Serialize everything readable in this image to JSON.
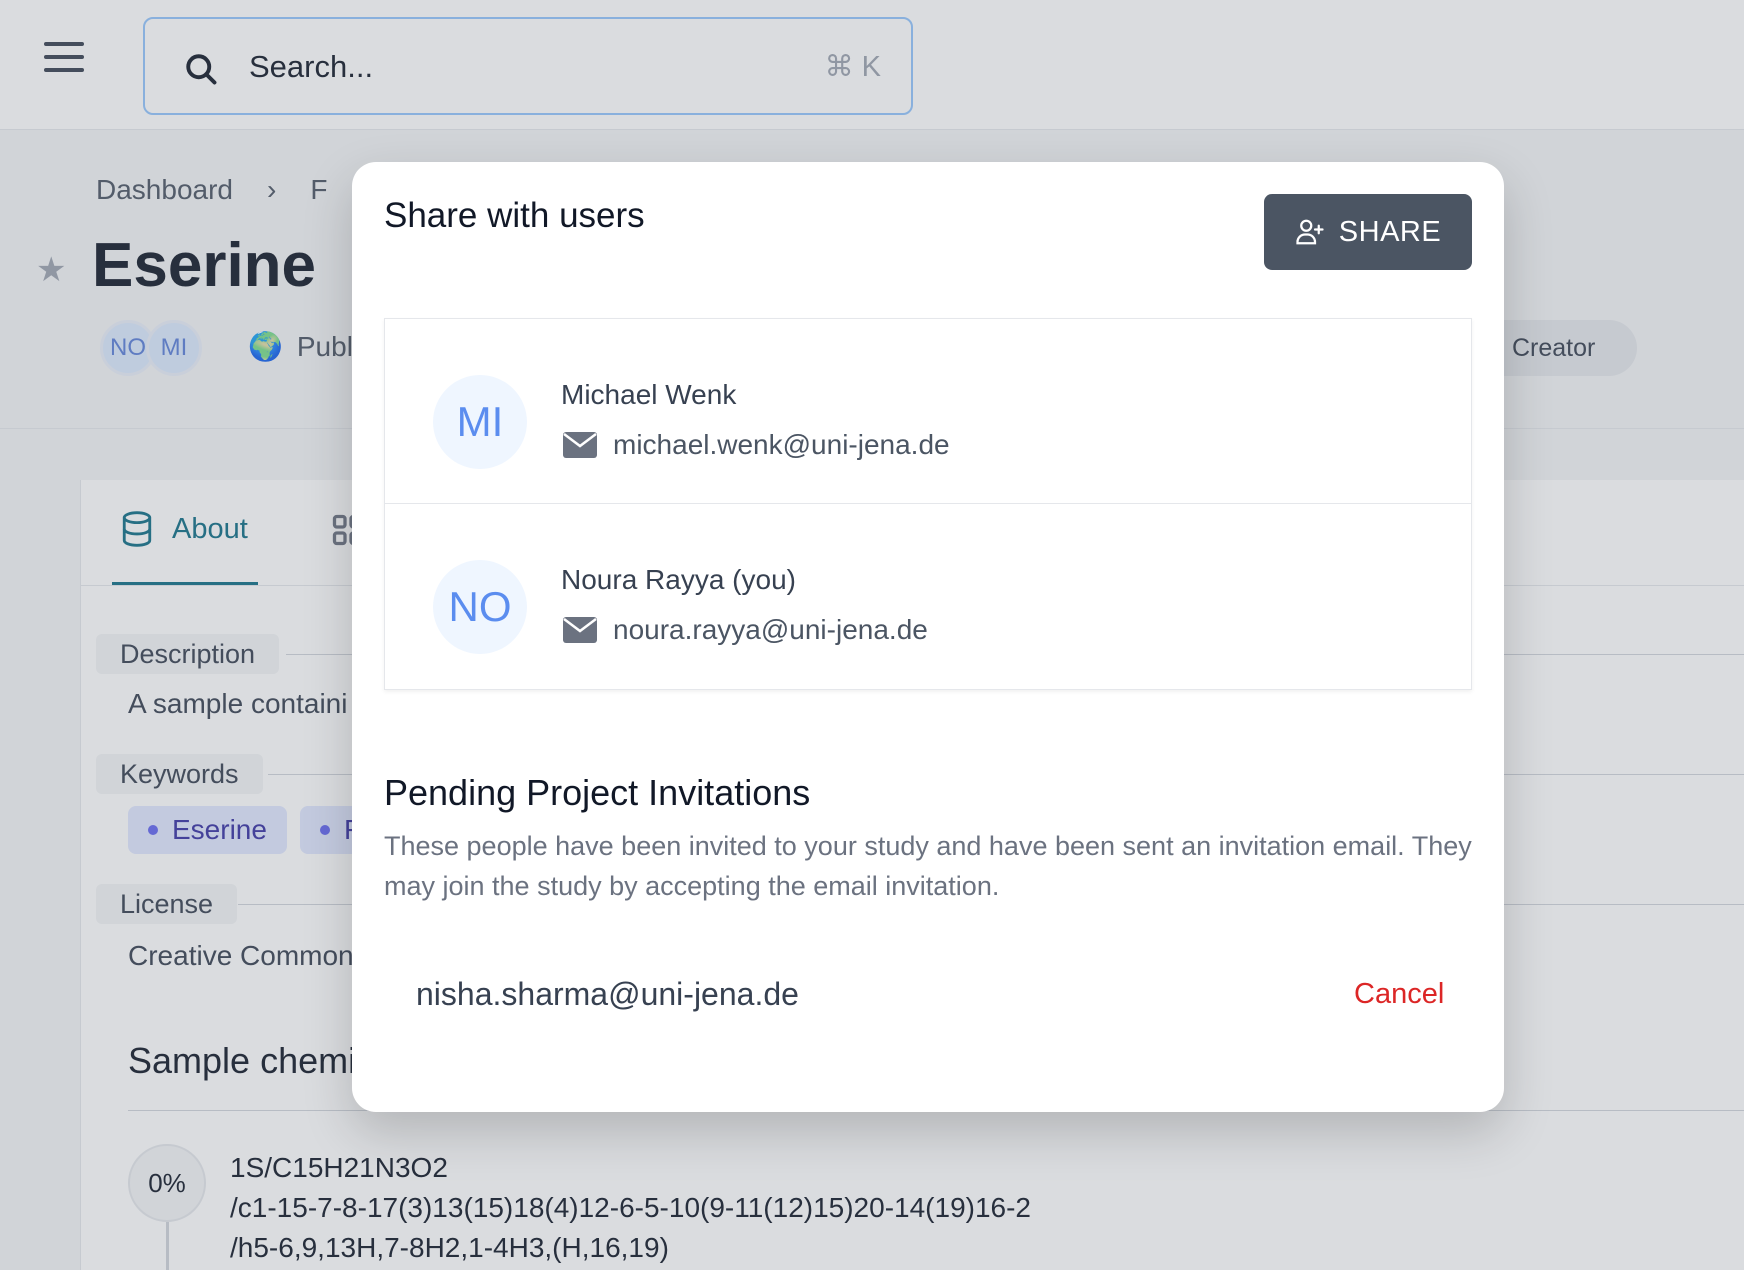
{
  "search": {
    "placeholder": "Search...",
    "shortcut": "⌘ K"
  },
  "breadcrumb": {
    "items": [
      "Dashboard",
      "F"
    ]
  },
  "page": {
    "title": "Eserine",
    "avatars": [
      "NO",
      "MI"
    ],
    "visibility": "Publi",
    "role_badge": "Creator"
  },
  "tabs": {
    "about": "About"
  },
  "sections": {
    "description_label": "Description",
    "description_text": "A sample containi",
    "keywords_label": "Keywords",
    "keywords": [
      "Eserine",
      "F"
    ],
    "license_label": "License",
    "license_text": "Creative Common",
    "chemicals_title": "Sample chemi",
    "progress": "0%",
    "inchi_lines": [
      "1S/C15H21N3O2",
      "/c1-15-7-8-17(3)13(15)18(4)12-6-5-10(9-11(12)15)20-14(19)16-2",
      "/h5-6,9,13H,7-8H2,1-4H3,(H,16,19)"
    ]
  },
  "modal": {
    "title": "Share with users",
    "share_button": "SHARE",
    "users": [
      {
        "initials": "MI",
        "name": "Michael Wenk",
        "email": "michael.wenk@uni-jena.de"
      },
      {
        "initials": "NO",
        "name": "Noura Rayya (you)",
        "email": "noura.rayya@uni-jena.de"
      }
    ],
    "pending_title": "Pending Project Invitations",
    "pending_desc": "These people have been invited to your study and have been sent an invitation email. They may join the study by accepting the email invitation.",
    "invitations": [
      {
        "email": "nisha.sharma@uni-jena.de",
        "action": "Cancel"
      }
    ]
  },
  "colors": {
    "accent": "#0f6e86",
    "share_button": "#4b5563",
    "cancel": "#dc2626",
    "avatar_text": "#5b8def"
  }
}
